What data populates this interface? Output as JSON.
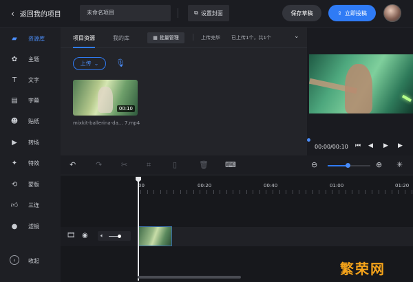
{
  "header": {
    "back_label": "返回我的项目",
    "project_name": "未命名项目",
    "cover_button": "设置封面",
    "save_draft": "保存草稿",
    "publish": "立即投稿"
  },
  "sidebar": {
    "items": [
      {
        "label": "资源库",
        "icon": "folder-icon"
      },
      {
        "label": "主题",
        "icon": "theme-icon"
      },
      {
        "label": "文字",
        "icon": "text-icon"
      },
      {
        "label": "字幕",
        "icon": "subtitle-icon"
      },
      {
        "label": "贴纸",
        "icon": "sticker-icon"
      },
      {
        "label": "转场",
        "icon": "transition-icon"
      },
      {
        "label": "特效",
        "icon": "effects-icon"
      },
      {
        "label": "蒙版",
        "icon": "mask-icon"
      },
      {
        "label": "三连",
        "icon": "thumbs-up-icon"
      },
      {
        "label": "滤镜",
        "icon": "filter-icon"
      }
    ],
    "collapse_label": "收起"
  },
  "resource": {
    "tabs": [
      "项目资源",
      "我的库"
    ],
    "batch_manage": "批量管理",
    "upload_status": "上传完毕",
    "upload_count": "已上传1个，共1个",
    "upload_button": "上传",
    "media": [
      {
        "duration": "00:10",
        "name": "mixkit-ballerina-da... 7.mp4"
      }
    ]
  },
  "preview": {
    "time": "00:00/00:10"
  },
  "timeline": {
    "ruler_labels": [
      "00",
      "00:20",
      "00:40",
      "01:00",
      "01:20"
    ]
  },
  "watermark": "繁荣网",
  "colors": {
    "accent": "#2f7bf5",
    "background": "#15161a",
    "panel": "#232429"
  }
}
